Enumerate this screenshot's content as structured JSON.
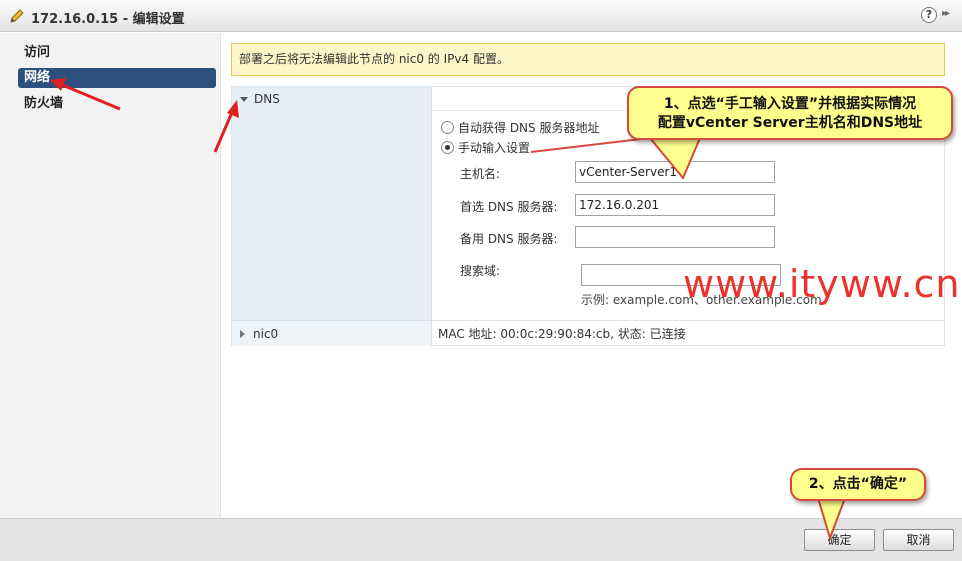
{
  "window": {
    "title": "172.16.0.15 - 编辑设置",
    "help_glyph": "?",
    "expand_glyph": "▸▸"
  },
  "sidebar": {
    "items": [
      {
        "label": "访问"
      },
      {
        "label": "网络",
        "selected": true
      },
      {
        "label": "防火墙"
      }
    ]
  },
  "notice": "部署之后将无法编辑此节点的 nic0 的 IPv4 配置。",
  "dns": {
    "section_label": "DNS",
    "auto_option": "自动获得 DNS 服务器地址",
    "manual_option": "手动输入设置",
    "selected": "manual",
    "hostname_label": "主机名:",
    "hostname_value": "vCenter-Server1",
    "preferred_dns_label": "首选 DNS 服务器:",
    "preferred_dns_value": "172.16.0.201",
    "alternate_dns_label": "备用 DNS 服务器:",
    "alternate_dns_value": "",
    "search_domain_label": "搜索域:",
    "search_domain_value": "",
    "search_domain_hint": "示例: example.com、other.example.com"
  },
  "nic0": {
    "label": "nic0",
    "info": "MAC 地址: 00:0c:29:90:84:cb, 状态: 已连接"
  },
  "buttons": {
    "ok": "确定",
    "cancel": "取消"
  },
  "annotations": {
    "callout1_line1": "1、点选“手工输入设置”并根据实际情况",
    "callout1_line2": "配置vCenter Server主机名和DNS地址",
    "callout2": "2、点击“确定”",
    "watermark": "www.ityww.cn"
  },
  "colors": {
    "selected_nav": "#2d4f7d",
    "notice_bg": "#fdf6c9",
    "callout_bg": "#ffff8d",
    "callout_border": "#d54a3c",
    "arrow_red": "#e02020",
    "watermark_red": "#e9332c"
  }
}
